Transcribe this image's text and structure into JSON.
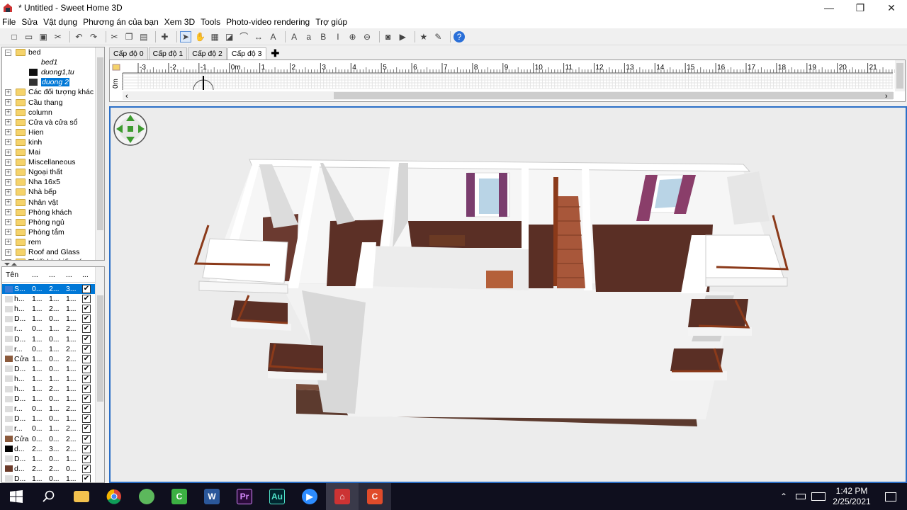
{
  "window": {
    "title": "* Untitled - Sweet Home 3D",
    "minimize": "—",
    "maximize": "❐",
    "close": "✕"
  },
  "menu": [
    "File",
    "Sửa",
    "Vật dụng",
    "Phương án của bạn",
    "Xem 3D",
    "Tools",
    "Photo-video rendering",
    "Trợ giúp"
  ],
  "toolbar_icons": [
    "new-file-icon",
    "open-icon",
    "save-icon",
    "cut-tool-icon",
    "sep",
    "undo-icon",
    "redo-icon",
    "sep",
    "cut-icon",
    "copy-icon",
    "paste-icon",
    "sep",
    "add-furniture-icon",
    "sep",
    "select-arrow-icon",
    "pan-hand-icon",
    "create-walls-icon",
    "create-rooms-icon",
    "create-polylines-icon",
    "create-dimensions-icon",
    "create-labels-icon",
    "sep",
    "increase-text-icon",
    "decrease-text-icon",
    "bold-text-icon",
    "italic-text-icon",
    "zoom-in-icon",
    "zoom-out-icon",
    "sep",
    "create-photo-icon",
    "create-video-icon",
    "sep",
    "import-furniture-icon",
    "edit-3d-icon",
    "sep",
    "help-icon"
  ],
  "tree": {
    "expanded_group": "bed",
    "children": [
      "bed1",
      "duong1,tu",
      "duong 2"
    ],
    "selected_child": "duong 2",
    "groups": [
      "Các đối tượng khác",
      "Cầu thang",
      "column",
      "Cửa và cửa sổ",
      "Hien",
      "kinh",
      "Mai",
      "Miscellaneous",
      "Ngoại thất",
      "Nha 16x5",
      "Nhà bếp",
      "Nhân vật",
      "Phòng khách",
      "Phòng ngủ",
      "Phòng tắm",
      "rem",
      "Roof and Glass",
      "Thiết bị chiếu sáng"
    ]
  },
  "furniture_table": {
    "headers": [
      "Tên",
      "...",
      "...",
      "...",
      "..."
    ],
    "rows": [
      {
        "name": "S...",
        "c1": "0...",
        "c2": "2...",
        "c3": "3...",
        "visible": "✔",
        "icon": "#3a7bd5",
        "selected": true
      },
      {
        "name": "h...",
        "c1": "1...",
        "c2": "1...",
        "c3": "1...",
        "visible": "✔",
        "icon": "#ddd"
      },
      {
        "name": "h...",
        "c1": "1...",
        "c2": "2...",
        "c3": "1...",
        "visible": "✔",
        "icon": "#ddd"
      },
      {
        "name": "D...",
        "c1": "1...",
        "c2": "0...",
        "c3": "1...",
        "visible": "✔",
        "icon": "#ddd"
      },
      {
        "name": "r...",
        "c1": "0...",
        "c2": "1...",
        "c3": "2...",
        "visible": "✔",
        "icon": "#ddd"
      },
      {
        "name": "D...",
        "c1": "1...",
        "c2": "0...",
        "c3": "1...",
        "visible": "✔",
        "icon": "#ddd"
      },
      {
        "name": "r...",
        "c1": "0...",
        "c2": "1...",
        "c3": "2...",
        "visible": "✔",
        "icon": "#ddd"
      },
      {
        "name": "Cửa",
        "c1": "1...",
        "c2": "0...",
        "c3": "2...",
        "visible": "✔",
        "icon": "#8b5a3c"
      },
      {
        "name": "D...",
        "c1": "1...",
        "c2": "0...",
        "c3": "1...",
        "visible": "✔",
        "icon": "#ddd"
      },
      {
        "name": "h...",
        "c1": "1...",
        "c2": "1...",
        "c3": "1...",
        "visible": "✔",
        "icon": "#ddd"
      },
      {
        "name": "h...",
        "c1": "1...",
        "c2": "2...",
        "c3": "1...",
        "visible": "✔",
        "icon": "#ddd"
      },
      {
        "name": "D...",
        "c1": "1...",
        "c2": "0...",
        "c3": "1...",
        "visible": "✔",
        "icon": "#ddd"
      },
      {
        "name": "r...",
        "c1": "0...",
        "c2": "1...",
        "c3": "2...",
        "visible": "✔",
        "icon": "#ddd"
      },
      {
        "name": "D...",
        "c1": "1...",
        "c2": "0...",
        "c3": "1...",
        "visible": "✔",
        "icon": "#ddd"
      },
      {
        "name": "r...",
        "c1": "0...",
        "c2": "1...",
        "c3": "2...",
        "visible": "✔",
        "icon": "#ddd"
      },
      {
        "name": "Cửa",
        "c1": "0...",
        "c2": "0...",
        "c3": "2...",
        "visible": "✔",
        "icon": "#8b5a3c"
      },
      {
        "name": "d...",
        "c1": "2...",
        "c2": "3...",
        "c3": "2...",
        "visible": "✔",
        "icon": "#000"
      },
      {
        "name": "D...",
        "c1": "1...",
        "c2": "0...",
        "c3": "1...",
        "visible": "✔",
        "icon": "#ddd"
      },
      {
        "name": "d...",
        "c1": "2...",
        "c2": "2...",
        "c3": "0...",
        "visible": "✔",
        "icon": "#6b3b2a"
      },
      {
        "name": "D...",
        "c1": "1...",
        "c2": "0...",
        "c3": "1...",
        "visible": "✔",
        "icon": "#ddd"
      }
    ]
  },
  "level_tabs": [
    "Cấp độ 0",
    "Cấp độ 1",
    "Cấp độ 2",
    "Cấp độ 3"
  ],
  "active_level": "Cấp độ 3",
  "add_level": "✚",
  "ruler": {
    "labels": [
      "-3",
      "-2",
      "-1",
      "0m",
      "1",
      "2",
      "3",
      "4",
      "5",
      "6",
      "7",
      "8",
      "9",
      "10",
      "11",
      "12",
      "13",
      "14",
      "15",
      "16",
      "17",
      "18",
      "19",
      "20",
      "21"
    ],
    "vertical_label": "0m"
  },
  "taskbar": {
    "apps": [
      "windows-start",
      "search",
      "file-explorer",
      "chrome",
      "greenshot",
      "camtasia",
      "word",
      "premiere",
      "audition",
      "zoom",
      "sweet-home-3d",
      "camtasia-recorder"
    ],
    "time": "1:42 PM",
    "date": "2/25/2021"
  },
  "colors": {
    "accent": "#0078d7",
    "floor": "#5a2f25",
    "wall": "#ffffff",
    "rail": "#8b3a1a",
    "curtain": "#7a3d6e",
    "stairs": "#a8573a"
  }
}
